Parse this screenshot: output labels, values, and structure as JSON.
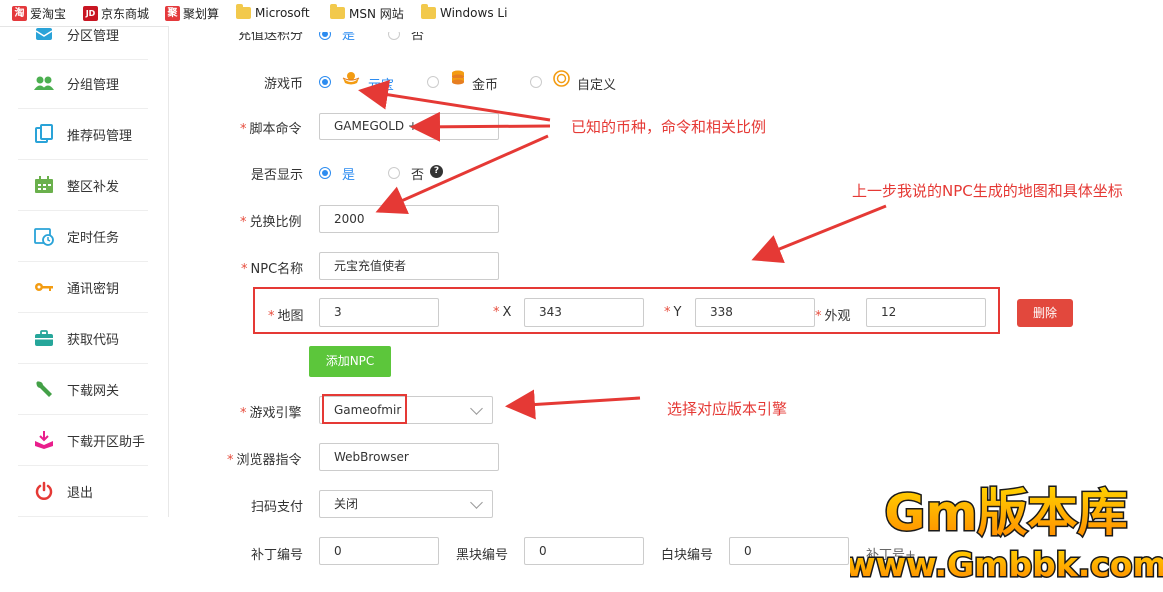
{
  "bookmarks": [
    {
      "label": "爱淘宝",
      "icon": "taobao-icon",
      "icon_glyph": "淘",
      "color": "#e4393c"
    },
    {
      "label": "京东商城",
      "icon": "jd-icon",
      "icon_glyph": "JD",
      "color": "#c81623"
    },
    {
      "label": "聚划算",
      "icon": "juhuasuan-icon",
      "icon_glyph": "聚",
      "color": "#e4393c"
    },
    {
      "label": "Microsoft",
      "icon": "folder-icon"
    },
    {
      "label": "MSN 网站",
      "icon": "folder-icon"
    },
    {
      "label": "Windows Li",
      "icon": "folder-icon"
    }
  ],
  "sidebar": {
    "items": [
      {
        "label": "分区管理",
        "icon": "partition-icon"
      },
      {
        "label": "分组管理",
        "icon": "group-users-icon"
      },
      {
        "label": "推荐码管理",
        "icon": "copy-code-icon"
      },
      {
        "label": "整区补发",
        "icon": "calendar-icon"
      },
      {
        "label": "定时任务",
        "icon": "clock-calendar-icon"
      },
      {
        "label": "通讯密钥",
        "icon": "key-icon"
      },
      {
        "label": "获取代码",
        "icon": "briefcase-icon"
      },
      {
        "label": "下载网关",
        "icon": "wrench-icon"
      },
      {
        "label": "下载开区助手",
        "icon": "download-box-icon"
      },
      {
        "label": "退出",
        "icon": "power-icon"
      }
    ]
  },
  "form": {
    "recharge_points": {
      "label": "充值送积分",
      "opt_yes": "是",
      "opt_no": "否",
      "selected": "是"
    },
    "game_currency": {
      "label": "游戏币",
      "options": [
        "元宝",
        "金币",
        "自定义"
      ],
      "selected": "元宝"
    },
    "script_command": {
      "label": "脚本命令",
      "value": "GAMEGOLD +"
    },
    "show": {
      "label": "是否显示",
      "opt_yes": "是",
      "opt_no": "否",
      "help": "?",
      "selected": "是"
    },
    "ratio": {
      "label": "兑换比例",
      "value": "2000"
    },
    "npc_name": {
      "label": "NPC名称",
      "value": "元宝充值使者"
    },
    "npc": {
      "map_label": "地图",
      "map_value": "3",
      "x_label": "X",
      "x_value": "343",
      "y_label": "Y",
      "y_value": "338",
      "look_label": "外观",
      "look_value": "12",
      "delete_label": "删除",
      "add_label": "添加NPC"
    },
    "engine": {
      "label": "游戏引擎",
      "value": "Gameofmir"
    },
    "browser_cmd": {
      "label": "浏览器指令",
      "value": "WebBrowser"
    },
    "scan_pay": {
      "label": "扫码支付",
      "value": "关闭"
    },
    "patch": {
      "label": "补丁编号",
      "value": "0"
    },
    "black_block": {
      "label": "黑块编号",
      "value": "0"
    },
    "white_block": {
      "label": "白块编号",
      "value": "0"
    },
    "extra_label": "补丁号+"
  },
  "annotations": {
    "currency_note": "已知的币种，命令和相关比例",
    "npc_note": "上一步我说的NPC生成的地图和具体坐标",
    "engine_note": "选择对应版本引擎",
    "accent": "#e53935"
  },
  "watermark": {
    "title": "Gm版本库",
    "url": "www.Gmbbk.com"
  }
}
